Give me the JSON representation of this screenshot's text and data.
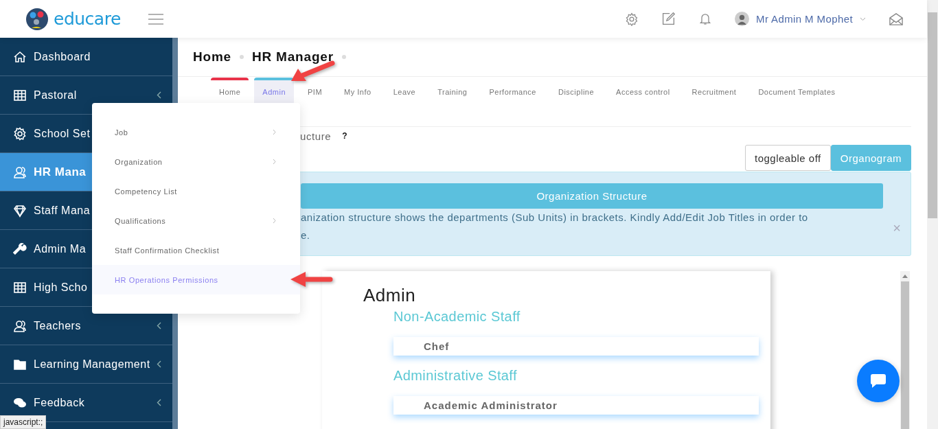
{
  "header": {
    "brand": "educare",
    "user_name": "Mr Admin M Mophet"
  },
  "sidebar": {
    "items": [
      {
        "label": "Dashboard",
        "active": false,
        "expandable": false
      },
      {
        "label": "Pastoral",
        "active": false,
        "expandable": true
      },
      {
        "label": "School Set",
        "active": false
      },
      {
        "label": "HR Mana",
        "active": true
      },
      {
        "label": "Staff Mana",
        "active": false
      },
      {
        "label": "Admin Ma",
        "active": false
      },
      {
        "label": "High Scho",
        "active": false
      },
      {
        "label": "Teachers",
        "active": false,
        "expandable": true
      },
      {
        "label": "Learning Management",
        "active": false,
        "expandable": true
      },
      {
        "label": "Feedback",
        "active": false,
        "expandable": true
      }
    ]
  },
  "breadcrumb": [
    "Home",
    "HR Manager"
  ],
  "tabs": [
    {
      "label": "Home",
      "selected": false,
      "color": "#e8334a"
    },
    {
      "label": "Admin",
      "selected": true,
      "color": "#5bc0de"
    },
    {
      "label": "PIM",
      "selected": false
    },
    {
      "label": "My Info",
      "selected": false
    },
    {
      "label": "Leave",
      "selected": false
    },
    {
      "label": "Training",
      "selected": false
    },
    {
      "label": "Performance",
      "selected": false
    },
    {
      "label": "Discipline",
      "selected": false
    },
    {
      "label": "Access control",
      "selected": false
    },
    {
      "label": "Recruitment",
      "selected": false
    },
    {
      "label": "Document Templates",
      "selected": false
    }
  ],
  "page_title": "ucture",
  "help": "?",
  "buttons": [
    {
      "label": "toggleable off",
      "kind": "outline"
    },
    {
      "label": "Organogram",
      "kind": "primary"
    }
  ],
  "alert": {
    "heading": "Organization Structure",
    "text_lines": [
      "anization structure shows the departments (Sub Units) in brackets. Kindly Add/Edit Job Titles in order to",
      "e."
    ],
    "close": "×"
  },
  "organogram": {
    "title": "Admin",
    "groups": [
      {
        "name": "Non-Academic Staff",
        "positions": [
          "Chef"
        ]
      },
      {
        "name": "Administrative Staff",
        "positions": [
          "Academic Administrator"
        ]
      }
    ]
  },
  "dropdown": {
    "items": [
      {
        "label": "Job",
        "has_submenu": true,
        "selected": false
      },
      {
        "label": "Organization",
        "has_submenu": true,
        "selected": false
      },
      {
        "label": "Competency List",
        "has_submenu": false,
        "selected": false
      },
      {
        "label": "Qualifications",
        "has_submenu": true,
        "selected": false
      },
      {
        "label": "Staff Confirmation Checklist",
        "has_submenu": false,
        "selected": false
      },
      {
        "label": "HR Operations Permissions",
        "has_submenu": false,
        "selected": true
      }
    ]
  },
  "status_url": "javascript:;"
}
